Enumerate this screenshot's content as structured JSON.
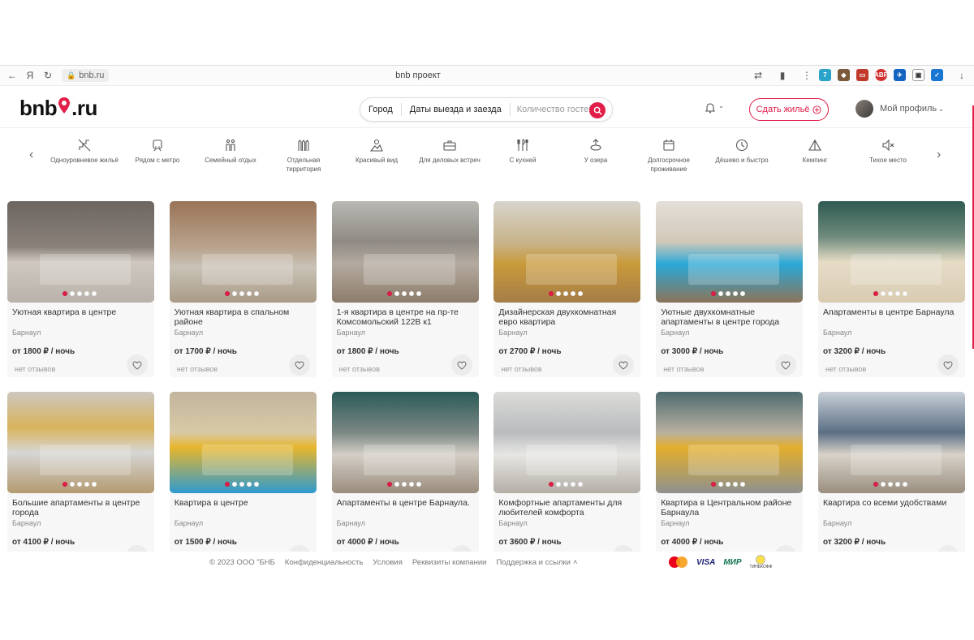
{
  "browser": {
    "url": "bnb.ru",
    "tab_title": "bnb проект"
  },
  "header": {
    "logo_left": "bnb",
    "logo_right": ".ru",
    "search": {
      "city": "Город",
      "dates": "Даты выезда и заезда",
      "guests_placeholder": "Количество гостей"
    },
    "host_button": "Сдать жильё",
    "profile": "Мой профиль"
  },
  "categories": [
    {
      "icon": "no-stairs-icon",
      "label": "Одноуровневое жильё"
    },
    {
      "icon": "metro-icon",
      "label": "Рядом с метро"
    },
    {
      "icon": "family-icon",
      "label": "Семейный отдых"
    },
    {
      "icon": "fence-icon",
      "label": "Отдельная территория"
    },
    {
      "icon": "view-icon",
      "label": "Красивый вид"
    },
    {
      "icon": "briefcase-icon",
      "label": "Для деловых встреч"
    },
    {
      "icon": "kitchen-icon",
      "label": "С кухней"
    },
    {
      "icon": "lake-icon",
      "label": "У озера"
    },
    {
      "icon": "calendar-icon",
      "label": "Долгосрочное проживание"
    },
    {
      "icon": "clock-icon",
      "label": "Дёшево и быстро"
    },
    {
      "icon": "tent-icon",
      "label": "Кемпинг"
    },
    {
      "icon": "mute-icon",
      "label": "Тихое место"
    }
  ],
  "listings": [
    {
      "title": "Уютная квартира в центре",
      "city": "Барнаул",
      "price": "от 1800 ₽ / ночь",
      "reviews": "нет отзывов"
    },
    {
      "title": "Уютная квартира в спальном районе",
      "city": "Барнаул",
      "price": "от 1700 ₽ / ночь",
      "reviews": "нет отзывов"
    },
    {
      "title": "1-я квартира в центре на пр-те Комсомольский 122В к1",
      "city": "Барнаул",
      "price": "от 1800 ₽ / ночь",
      "reviews": "нет отзывов"
    },
    {
      "title": "Дизайнерская двухкомнатная евро квартира",
      "city": "Барнаул",
      "price": "от 2700 ₽ / ночь",
      "reviews": "нет отзывов"
    },
    {
      "title": "Уютные двухкомнатные апартаменты в центре города",
      "city": "Барнаул",
      "price": "от 3000 ₽ / ночь",
      "reviews": "нет отзывов"
    },
    {
      "title": "Апартаменты в центре Барнаула",
      "city": "Барнаул",
      "price": "от 3200 ₽ / ночь",
      "reviews": "нет отзывов"
    },
    {
      "title": "Большие апартаменты в центре города",
      "city": "Барнаул",
      "price": "от 4100 ₽ / ночь",
      "reviews": ""
    },
    {
      "title": "Квартира в центре",
      "city": "Барнаул",
      "price": "от 1500 ₽ / ночь",
      "reviews": ""
    },
    {
      "title": "Апартаменты в центре Барнаула.",
      "city": "Барнаул",
      "price": "от 4000 ₽ / ночь",
      "reviews": ""
    },
    {
      "title": "Комфортные апартаменты для любителей комфорта",
      "city": "Барнаул",
      "price": "от 3600 ₽ / ночь",
      "reviews": ""
    },
    {
      "title": "Квартира в Центральном районе Барнаула",
      "city": "Барнаул",
      "price": "от 4000 ₽ / ночь",
      "reviews": ""
    },
    {
      "title": "Квартира со всеми удобствами",
      "city": "Барнаул",
      "price": "от 3200 ₽ / ночь",
      "reviews": ""
    }
  ],
  "footer": {
    "copyright": "© 2023 ООО \"БНБ",
    "links": [
      "Конфиденциальность",
      "Условия",
      "Реквизиты компании",
      "Поддержка и ссылки"
    ],
    "payments": [
      "Mastercard",
      "VISA",
      "МИР",
      "ТИНЬКОФФ"
    ]
  },
  "colors": {
    "accent": "#e11d48"
  }
}
